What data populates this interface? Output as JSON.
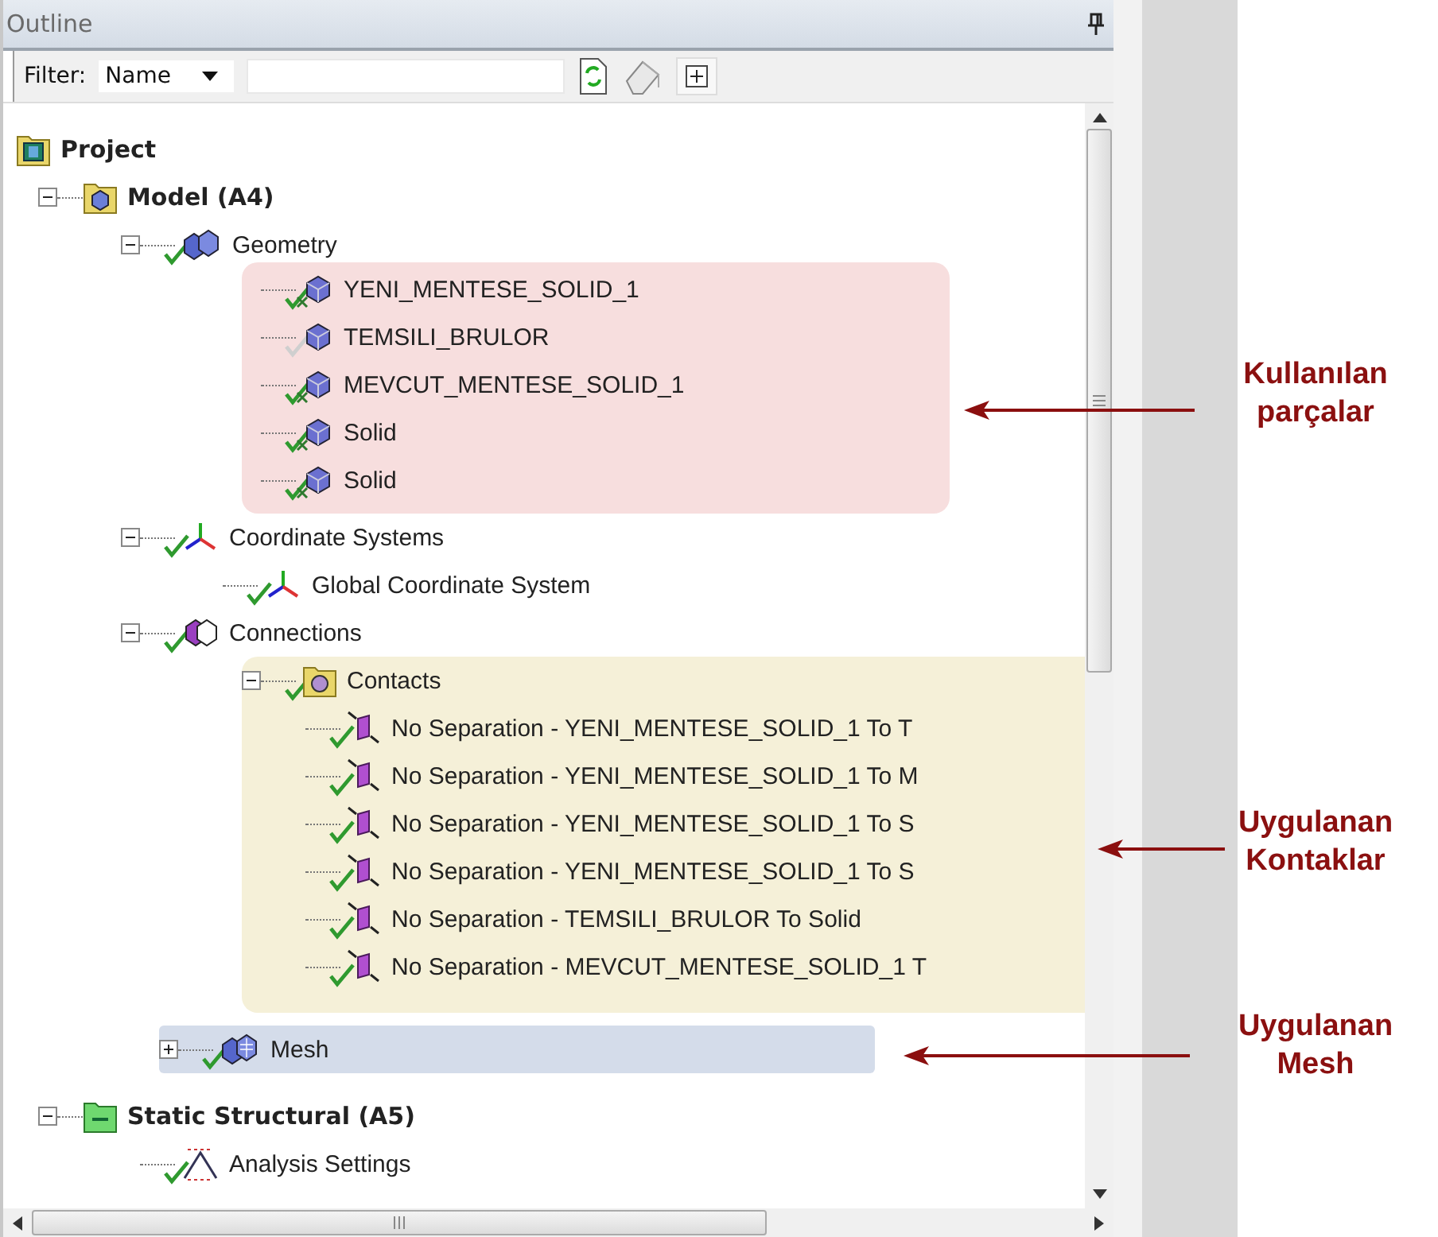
{
  "panel": {
    "title": "Outline",
    "filter_label": "Filter:",
    "filter_by": "Name"
  },
  "tree": [
    {
      "label": "Project",
      "kind": "project",
      "bold": true,
      "checked": false,
      "children": [
        {
          "label": "Model (A4)",
          "kind": "model",
          "bold": true,
          "checked": false,
          "expanded": true,
          "children": [
            {
              "label": "Geometry",
              "kind": "geometry",
              "bold": false,
              "checked": true,
              "expanded": true,
              "highlighted": true,
              "children": [
                {
                  "label": "YENI_MENTESE_SOLID_1",
                  "kind": "part",
                  "bold": false,
                  "checked": true,
                  "suppressed": false
                },
                {
                  "label": "TEMSILI_BRULOR",
                  "kind": "part",
                  "bold": false,
                  "checked": true,
                  "suppressed": true
                },
                {
                  "label": "MEVCUT_MENTESE_SOLID_1",
                  "kind": "part",
                  "bold": false,
                  "checked": true,
                  "suppressed": false
                },
                {
                  "label": "Solid",
                  "kind": "part",
                  "bold": false,
                  "checked": true,
                  "suppressed": false
                },
                {
                  "label": "Solid",
                  "kind": "part",
                  "bold": false,
                  "checked": true,
                  "suppressed": false
                }
              ]
            },
            {
              "label": "Coordinate Systems",
              "kind": "axes",
              "bold": false,
              "checked": true,
              "expanded": true,
              "children": [
                {
                  "label": "Global Coordinate System",
                  "kind": "axes",
                  "bold": false,
                  "checked": true
                }
              ]
            },
            {
              "label": "Connections",
              "kind": "connections",
              "bold": false,
              "checked": true,
              "expanded": true,
              "children": [
                {
                  "label": "Contacts",
                  "kind": "contacts",
                  "bold": false,
                  "checked": true,
                  "expanded": true,
                  "highlighted": true,
                  "children": [
                    {
                      "label": "No Separation - YENI_MENTESE_SOLID_1 To T",
                      "kind": "contact",
                      "bold": false,
                      "checked": true
                    },
                    {
                      "label": "No Separation - YENI_MENTESE_SOLID_1 To M",
                      "kind": "contact",
                      "bold": false,
                      "checked": true
                    },
                    {
                      "label": "No Separation - YENI_MENTESE_SOLID_1 To S",
                      "kind": "contact",
                      "bold": false,
                      "checked": true
                    },
                    {
                      "label": "No Separation - YENI_MENTESE_SOLID_1 To S",
                      "kind": "contact",
                      "bold": false,
                      "checked": true
                    },
                    {
                      "label": "No Separation - TEMSILI_BRULOR To Solid",
                      "kind": "contact",
                      "bold": false,
                      "checked": true
                    },
                    {
                      "label": "No Separation - MEVCUT_MENTESE_SOLID_1 T",
                      "kind": "contact",
                      "bold": false,
                      "checked": true
                    }
                  ]
                }
              ]
            },
            {
              "label": "Mesh",
              "kind": "mesh",
              "bold": false,
              "checked": true,
              "expanded": false,
              "highlighted": true
            }
          ]
        },
        {
          "label": "Static Structural (A5)",
          "kind": "analysis",
          "bold": true,
          "checked": false,
          "expanded": true,
          "children": [
            {
              "label": "Analysis Settings",
              "kind": "settings",
              "bold": false,
              "checked": true
            }
          ]
        }
      ]
    }
  ],
  "annotations": [
    {
      "text": "Kullanılan parçalar"
    },
    {
      "text": "Uygulanan Kontaklar"
    },
    {
      "text": "Uygulanan Mesh"
    }
  ]
}
